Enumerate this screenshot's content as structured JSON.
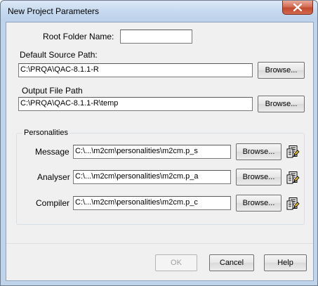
{
  "window": {
    "title": "New Project Parameters"
  },
  "root_folder": {
    "label": "Root Folder Name:",
    "value": ""
  },
  "source_path": {
    "label": "Default Source Path:",
    "value": "C:\\PRQA\\QAC-8.1.1-R",
    "browse": "Browse..."
  },
  "output_path": {
    "label": "Output File Path",
    "value": "C:\\PRQA\\QAC-8.1.1-R\\temp",
    "browse": "Browse..."
  },
  "personalities": {
    "title": "Personalities",
    "rows": [
      {
        "label": "Message",
        "value": "C:\\...\\m2cm\\personalities\\m2cm.p_s",
        "browse": "Browse...",
        "icon": "edit-file-icon"
      },
      {
        "label": "Analyser",
        "value": "C:\\...\\m2cm\\personalities\\m2cm.p_a",
        "browse": "Browse...",
        "icon": "edit-file-icon"
      },
      {
        "label": "Compiler",
        "value": "C:\\...\\m2cm\\personalities\\m2cm.p_c",
        "browse": "Browse...",
        "icon": "edit-file-icon"
      }
    ]
  },
  "footer": {
    "ok": "OK",
    "cancel": "Cancel",
    "help": "Help"
  },
  "colors": {
    "frame": "#bfd3ea",
    "client": "#f0f0f0",
    "close": "#c24a2e"
  }
}
